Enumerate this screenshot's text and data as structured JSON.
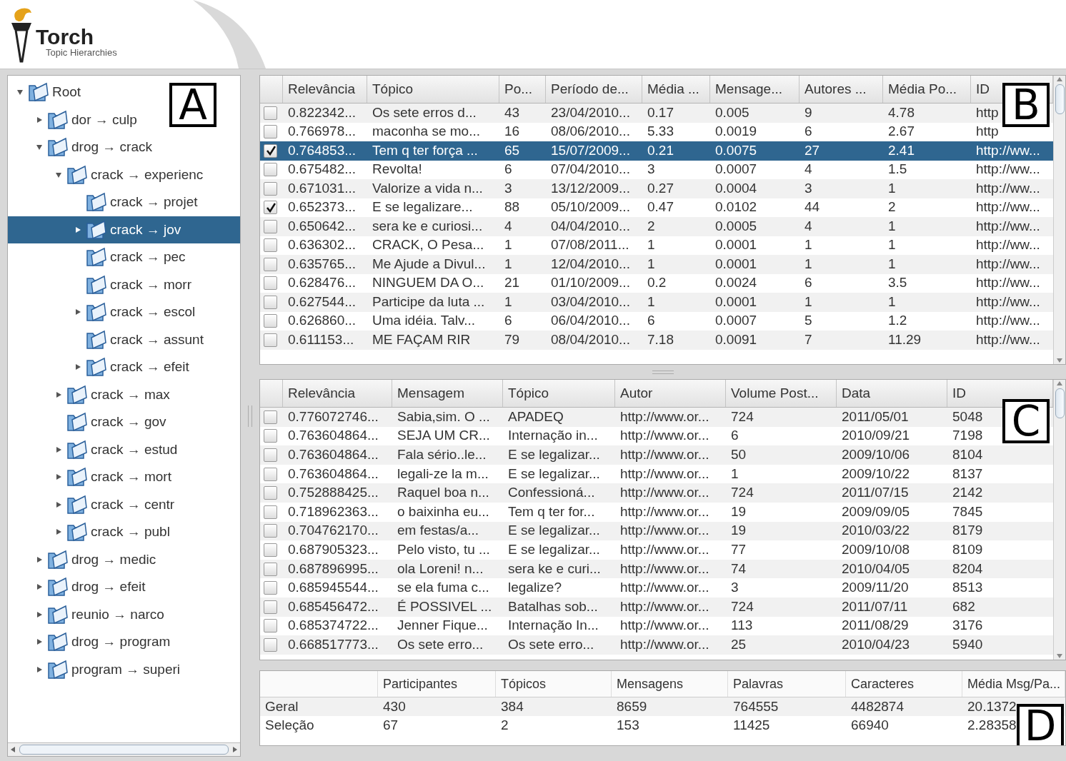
{
  "app": {
    "title": "Torch",
    "subtitle": "Topic Hierarchies"
  },
  "tree": {
    "panel_label": "A",
    "items": [
      {
        "label": "Root",
        "kind": "branch",
        "expanded": true,
        "selected": false,
        "children": [
          {
            "label": "dor → culp",
            "kind": "branch",
            "expanded": false,
            "selected": false
          },
          {
            "label": "drog → crack",
            "kind": "branch",
            "expanded": true,
            "selected": false,
            "children": [
              {
                "label": "crack → experienc",
                "kind": "branch",
                "expanded": true,
                "selected": false,
                "children": [
                  {
                    "label": "crack → projet",
                    "kind": "leaf",
                    "selected": false
                  },
                  {
                    "label": "crack → jov",
                    "kind": "branch",
                    "expanded": false,
                    "selected": true
                  },
                  {
                    "label": "crack → pec",
                    "kind": "leaf",
                    "selected": false
                  },
                  {
                    "label": "crack → morr",
                    "kind": "leaf",
                    "selected": false
                  },
                  {
                    "label": "crack → escol",
                    "kind": "branch",
                    "expanded": false,
                    "selected": false
                  },
                  {
                    "label": "crack → assunt",
                    "kind": "leaf",
                    "selected": false
                  },
                  {
                    "label": "crack → efeit",
                    "kind": "branch",
                    "expanded": false,
                    "selected": false
                  }
                ]
              },
              {
                "label": "crack → max",
                "kind": "branch",
                "expanded": false,
                "selected": false
              },
              {
                "label": "crack → gov",
                "kind": "leaf",
                "selected": false
              },
              {
                "label": "crack → estud",
                "kind": "branch",
                "expanded": false,
                "selected": false
              },
              {
                "label": "crack → mort",
                "kind": "branch",
                "expanded": false,
                "selected": false
              },
              {
                "label": "crack → centr",
                "kind": "branch",
                "expanded": false,
                "selected": false
              },
              {
                "label": "crack → publ",
                "kind": "branch",
                "expanded": false,
                "selected": false
              }
            ]
          },
          {
            "label": "drog → medic",
            "kind": "branch",
            "expanded": false,
            "selected": false
          },
          {
            "label": "drog → efeit",
            "kind": "branch",
            "expanded": false,
            "selected": false
          },
          {
            "label": "reunio → narco",
            "kind": "branch",
            "expanded": false,
            "selected": false
          },
          {
            "label": "drog → program",
            "kind": "branch",
            "expanded": false,
            "selected": false
          },
          {
            "label": "program → superi",
            "kind": "branch",
            "expanded": false,
            "selected": false
          }
        ]
      }
    ]
  },
  "topics_table": {
    "panel_label": "B",
    "columns": [
      "Relevância",
      "Tópico",
      "Po...",
      "Período de...",
      "Média ...",
      "Mensage...",
      "Autores ...",
      "Média Po...",
      "ID"
    ],
    "rows": [
      {
        "checked": false,
        "selected": false,
        "cells": [
          "0.822342...",
          "Os sete erros d...",
          "43",
          "23/04/2010...",
          "0.17",
          "0.005",
          "9",
          "4.78",
          "http"
        ]
      },
      {
        "checked": false,
        "selected": false,
        "cells": [
          "0.766978...",
          "maconha se mo...",
          "16",
          "08/06/2010...",
          "5.33",
          "0.0019",
          "6",
          "2.67",
          "http"
        ]
      },
      {
        "checked": true,
        "selected": true,
        "cells": [
          "0.764853...",
          "Tem q ter força ...",
          "65",
          "15/07/2009...",
          "0.21",
          "0.0075",
          "27",
          "2.41",
          "http://ww..."
        ]
      },
      {
        "checked": false,
        "selected": false,
        "cells": [
          "0.675482...",
          "Revolta!",
          "6",
          "07/04/2010...",
          "3",
          "0.0007",
          "4",
          "1.5",
          "http://ww..."
        ]
      },
      {
        "checked": false,
        "selected": false,
        "cells": [
          "0.671031...",
          "Valorize a vida n...",
          "3",
          "13/12/2009...",
          "0.27",
          "0.0004",
          "3",
          "1",
          "http://ww..."
        ]
      },
      {
        "checked": true,
        "selected": false,
        "cells": [
          "0.652373...",
          "E se legalizare...",
          "88",
          "05/10/2009...",
          "0.47",
          "0.0102",
          "44",
          "2",
          "http://ww..."
        ]
      },
      {
        "checked": false,
        "selected": false,
        "cells": [
          "0.650642...",
          "sera ke e curiosi...",
          "4",
          "04/04/2010...",
          "2",
          "0.0005",
          "4",
          "1",
          "http://ww..."
        ]
      },
      {
        "checked": false,
        "selected": false,
        "cells": [
          "0.636302...",
          "CRACK, O Pesa...",
          "1",
          "07/08/2011...",
          "1",
          "0.0001",
          "1",
          "1",
          "http://ww..."
        ]
      },
      {
        "checked": false,
        "selected": false,
        "cells": [
          "0.635765...",
          "Me Ajude a Divul...",
          "1",
          "12/04/2010...",
          "1",
          "0.0001",
          "1",
          "1",
          "http://ww..."
        ]
      },
      {
        "checked": false,
        "selected": false,
        "cells": [
          "0.628476...",
          "NINGUEM DA O...",
          "21",
          "01/10/2009...",
          "0.2",
          "0.0024",
          "6",
          "3.5",
          "http://ww..."
        ]
      },
      {
        "checked": false,
        "selected": false,
        "cells": [
          "0.627544...",
          "Participe da luta ...",
          "1",
          "03/04/2010...",
          "1",
          "0.0001",
          "1",
          "1",
          "http://ww..."
        ]
      },
      {
        "checked": false,
        "selected": false,
        "cells": [
          "0.626860...",
          "Uma idéia. Talv...",
          "6",
          "06/04/2010...",
          "6",
          "0.0007",
          "5",
          "1.2",
          "http://ww..."
        ]
      },
      {
        "checked": false,
        "selected": false,
        "cells": [
          "0.611153...",
          "ME FAÇAM RIR",
          "79",
          "08/04/2010...",
          "7.18",
          "0.0091",
          "7",
          "11.29",
          "http://ww..."
        ]
      }
    ]
  },
  "messages_table": {
    "panel_label": "C",
    "columns": [
      "Relevância",
      "Mensagem",
      "Tópico",
      "Autor",
      "Volume Post...",
      "Data",
      "ID"
    ],
    "rows": [
      {
        "checked": false,
        "cells": [
          "0.776072746...",
          "Sabia,sim. O ...",
          "APADEQ",
          "http://www.or...",
          "724",
          "2011/05/01",
          "5048"
        ]
      },
      {
        "checked": false,
        "cells": [
          "0.763604864...",
          "SEJA UM CR...",
          "Internação in...",
          "http://www.or...",
          "6",
          "2010/09/21",
          "7198"
        ]
      },
      {
        "checked": false,
        "cells": [
          "0.763604864...",
          "Fala sério..le...",
          "E se legalizar...",
          "http://www.or...",
          "50",
          "2009/10/06",
          "8104"
        ]
      },
      {
        "checked": false,
        "cells": [
          "0.763604864...",
          "legali-ze la m...",
          "E se legalizar...",
          "http://www.or...",
          "1",
          "2009/10/22",
          "8137"
        ]
      },
      {
        "checked": false,
        "cells": [
          "0.752888425...",
          "Raquel boa n...",
          "Confessioná...",
          "http://www.or...",
          "724",
          "2011/07/15",
          "2142"
        ]
      },
      {
        "checked": false,
        "cells": [
          "0.718962363...",
          "o baixinha eu...",
          "Tem q ter for...",
          "http://www.or...",
          "19",
          "2009/09/05",
          "7845"
        ]
      },
      {
        "checked": false,
        "cells": [
          "0.704762170...",
          "em festas/a...",
          "E se legalizar...",
          "http://www.or...",
          "19",
          "2010/03/22",
          "8179"
        ]
      },
      {
        "checked": false,
        "cells": [
          "0.687905323...",
          "Pelo visto, tu ...",
          "E se legalizar...",
          "http://www.or...",
          "77",
          "2009/10/08",
          "8109"
        ]
      },
      {
        "checked": false,
        "cells": [
          "0.687896995...",
          "ola Loreni! n...",
          "sera ke e curi...",
          "http://www.or...",
          "74",
          "2010/04/05",
          "8204"
        ]
      },
      {
        "checked": false,
        "cells": [
          "0.685945544...",
          "se ela fuma c...",
          "legalize?",
          "http://www.or...",
          "3",
          "2009/11/20",
          "8513"
        ]
      },
      {
        "checked": false,
        "cells": [
          "0.685456472...",
          "É POSSIVEL ...",
          "Batalhas sob...",
          "http://www.or...",
          "724",
          "2011/07/11",
          "682"
        ]
      },
      {
        "checked": false,
        "cells": [
          "0.685374722...",
          "Jenner Fique...",
          "Internação In...",
          "http://www.or...",
          "113",
          "2011/08/29",
          "3176"
        ]
      },
      {
        "checked": false,
        "cells": [
          "0.668517773...",
          "Os sete erro...",
          "Os sete erro...",
          "http://www.or...",
          "25",
          "2010/04/23",
          "5940"
        ]
      }
    ]
  },
  "stats_table": {
    "panel_label": "D",
    "columns": [
      "Participantes",
      "Tópicos",
      "Mensagens",
      "Palavras",
      "Caracteres",
      "Média Msg/Pa..."
    ],
    "rows": [
      {
        "label": "Geral",
        "cells": [
          "430",
          "384",
          "8659",
          "764555",
          "4482874",
          "20.1372"
        ]
      },
      {
        "label": "Seleção",
        "cells": [
          "67",
          "2",
          "153",
          "11425",
          "66940",
          "2.28358"
        ]
      }
    ]
  }
}
